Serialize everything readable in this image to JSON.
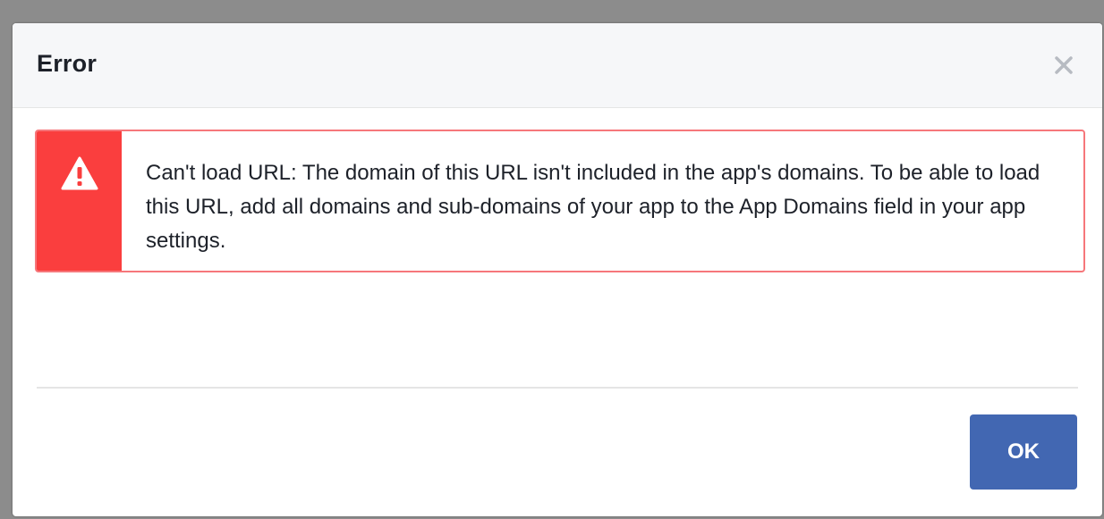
{
  "dialog": {
    "title": "Error",
    "close_icon": "close-icon"
  },
  "error_banner": {
    "icon": "warning-icon",
    "message": "Can't load URL: The domain of this URL isn't included in the app's domains. To be able to load this URL, add all domains and sub-domains of your app to the App Domains field in your app settings."
  },
  "footer": {
    "ok_label": "OK"
  },
  "colors": {
    "error_red": "#fa3e3e",
    "error_border": "#f6777b",
    "button_blue": "#4267b2",
    "header_bg": "#f6f7f9",
    "text": "#1d2129"
  }
}
